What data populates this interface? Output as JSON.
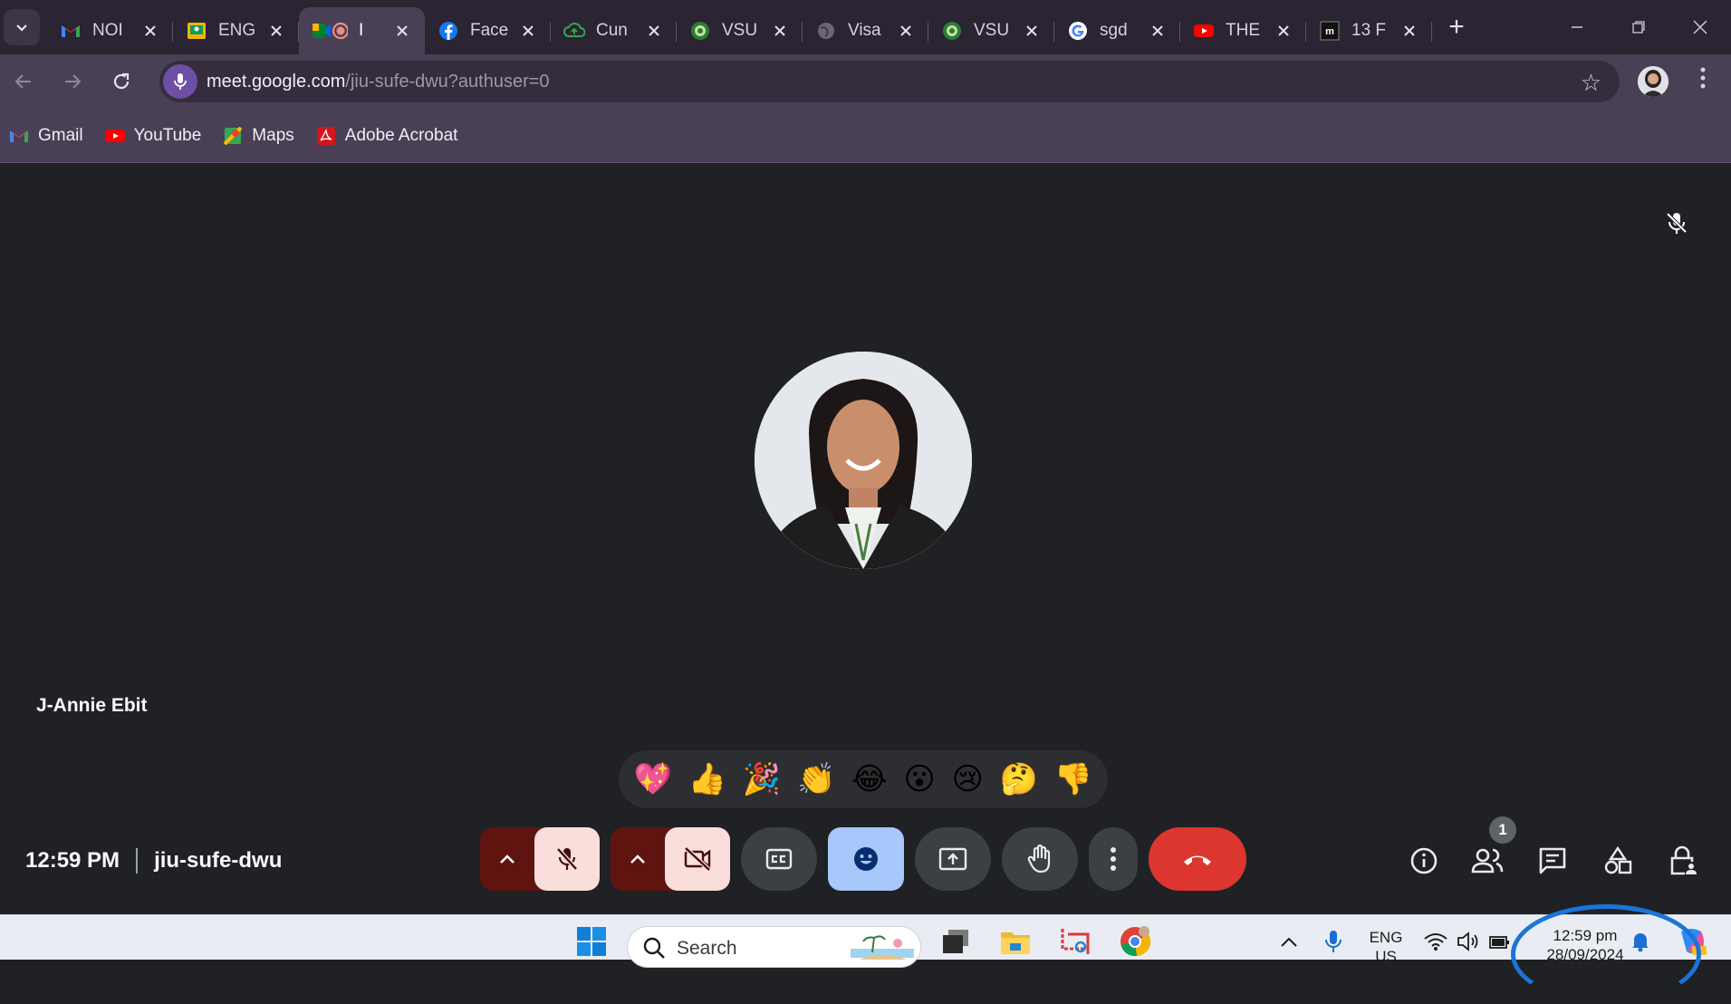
{
  "browser": {
    "tabs": [
      {
        "title": "NOI",
        "favicon": "gmail-icon",
        "active": false
      },
      {
        "title": "ENG",
        "favicon": "classroom-icon",
        "active": false
      },
      {
        "title": "I",
        "favicon": "meet-icon",
        "active": true
      },
      {
        "title": "Face",
        "favicon": "facebook-icon",
        "active": false
      },
      {
        "title": "Cun",
        "favicon": "cloud-icon",
        "active": false
      },
      {
        "title": "VSU",
        "favicon": "vsu-icon",
        "active": false
      },
      {
        "title": "Visa",
        "favicon": "globe-icon",
        "active": false
      },
      {
        "title": "VSU",
        "favicon": "vsu-icon",
        "active": false
      },
      {
        "title": "sgd",
        "favicon": "google-icon",
        "active": false
      },
      {
        "title": "THE",
        "favicon": "youtube-icon",
        "active": false
      },
      {
        "title": "13 F",
        "favicon": "m-icon",
        "active": false
      }
    ],
    "url_host": "meet.google.com",
    "url_path": "/jiu-sufe-dwu?authuser=0",
    "bookmarks": [
      {
        "label": "Gmail",
        "icon": "gmail-icon"
      },
      {
        "label": "YouTube",
        "icon": "youtube-icon"
      },
      {
        "label": "Maps",
        "icon": "maps-icon"
      },
      {
        "label": "Adobe Acrobat",
        "icon": "acrobat-icon"
      }
    ]
  },
  "meet": {
    "participant_name": "J-Annie Ebit",
    "time": "12:59 PM",
    "meeting_code": "jiu-sufe-dwu",
    "participants_count": "1",
    "reactions": [
      "💖",
      "👍",
      "🎉",
      "👏",
      "😂",
      "😮",
      "😢",
      "🤔",
      "👎"
    ]
  },
  "taskbar": {
    "search_label": "Search",
    "language_line1": "ENG",
    "language_line2": "US",
    "clock_time": "12:59 pm",
    "clock_date": "28/09/2024"
  },
  "colors": {
    "meet_background": "#202124",
    "hangup_red": "#dc362e",
    "emoji_button_blue": "#a8c7fa",
    "muted_pink": "#f9dedc",
    "annotation_blue": "#1b74d8"
  }
}
